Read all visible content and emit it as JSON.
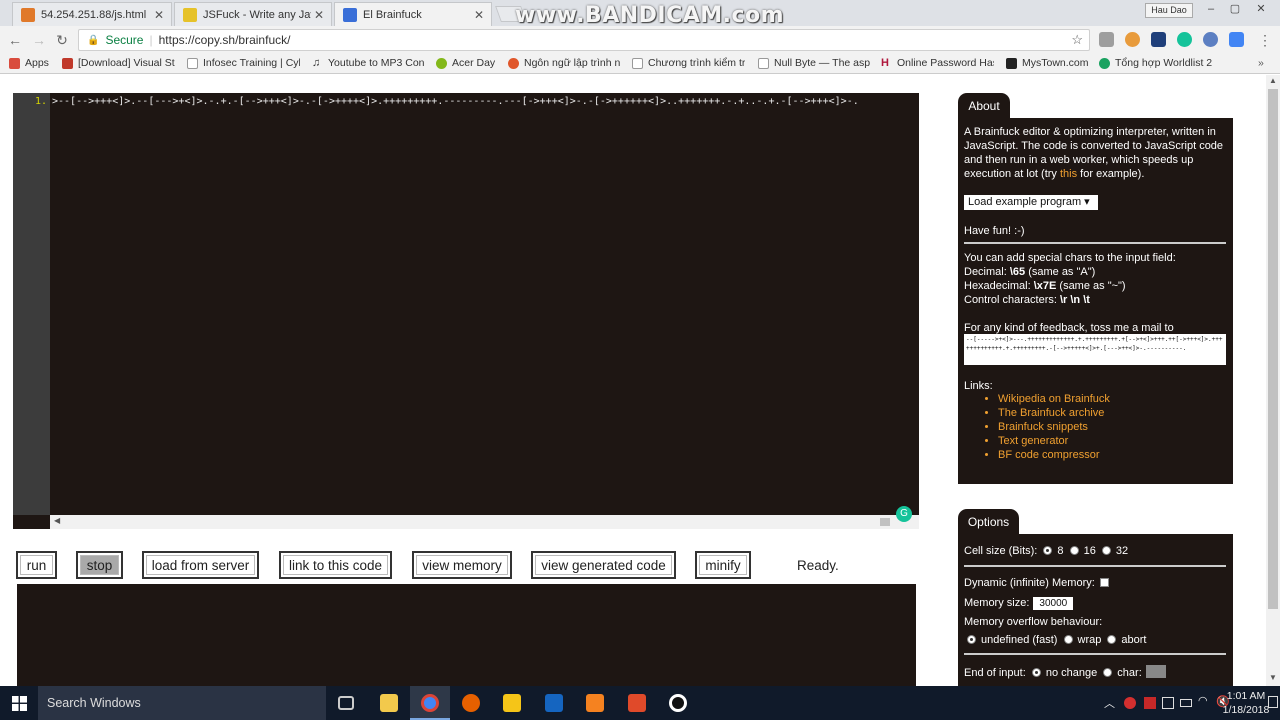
{
  "browser": {
    "tabs": [
      {
        "title": "54.254.251.88/js.html",
        "favicon_color": "#e0792a"
      },
      {
        "title": "JSFuck - Write any JavaSc",
        "favicon_color": "#e6c229"
      },
      {
        "title": "El Brainfuck",
        "favicon_color": "#3a6fd8"
      }
    ],
    "overlay_watermark": "www.BANDICAM.com",
    "profile_name": "Hau Dao",
    "window_controls": [
      "–",
      "▢",
      "✕"
    ],
    "address": {
      "secure_label": "Secure",
      "url": "https://copy.sh/brainfuck/"
    },
    "bookmarks": [
      {
        "label": "Apps",
        "icon_color": "#d94c3d"
      },
      {
        "label": "[Download] Visual St",
        "icon_color": "#c0392b"
      },
      {
        "label": "Infosec Training | Cyb",
        "icon_color": "#999999"
      },
      {
        "label": "Youtube to MP3 Con",
        "icon_color": "#333333"
      },
      {
        "label": "Acer Day",
        "icon_color": "#83b81a"
      },
      {
        "label": "Ngôn ngữ lập trình n",
        "icon_color": "#e0562a"
      },
      {
        "label": "Chương trình kiểm tr",
        "icon_color": "#999999"
      },
      {
        "label": "Null Byte — The aspi",
        "icon_color": "#999999"
      },
      {
        "label": "Online Password Has",
        "icon_color": "#b0173c"
      },
      {
        "label": "MysTown.com",
        "icon_color": "#222222"
      },
      {
        "label": "Tổng hợp Worldlist 2",
        "icon_color": "#1aa260"
      }
    ]
  },
  "editor": {
    "line_number": "1.",
    "code": ">--[-->+++<]>.--[--->+<]>.-.+.-[-->+++<]>-.-[->++++<]>.+++++++++.---------.---[->+++<]>-.-[->++++++<]>..+++++++.-.+..-.+.-[-->+++<]>-."
  },
  "controls": {
    "buttons": [
      "run",
      "stop",
      "load from server",
      "link to this code",
      "view memory",
      "view generated code",
      "minify"
    ],
    "status": "Ready."
  },
  "about": {
    "tab_label": "About",
    "intro_1": "A Brainfuck editor & optimizing interpreter, written in JavaScript. The code is converted to JavaScript code and then run in a web worker, which speeds up execution at lot (try ",
    "intro_link": "this",
    "intro_2": " for example).",
    "load_example": "Load example program ▾",
    "have_fun": "Have fun! :-)",
    "special_chars_title": "You can add special chars to the input field:",
    "decimal_label": "Decimal: ",
    "decimal_code": "\\65",
    "decimal_note": " (same as \"A\")",
    "hex_label": "Hexadecimal: ",
    "hex_code": "\\x7E",
    "hex_note": " (same as \"~\")",
    "control_label": "Control characters: ",
    "control_code": "\\r \\n \\t",
    "feedback": "For any kind of feedback, toss me a mail to",
    "mail_code": "--[----->+<]>---.+++++++++++++.+.+++++++++.+[-->+<]>+++.++[->+++<]>.+++++++++++++.+.+++++++++.-[-->+++++<]>+.[--->++<]>-.----------.",
    "links_label": "Links:",
    "links": [
      "Wikipedia on Brainfuck",
      "The Brainfuck archive",
      "Brainfuck snippets",
      "Text generator",
      "BF code compressor"
    ]
  },
  "options": {
    "tab_label": "Options",
    "cell_size_label": "Cell size (Bits):",
    "cell_sizes": [
      "8",
      "16",
      "32"
    ],
    "cell_size_selected": "8",
    "dynamic_memory_label": "Dynamic (infinite) Memory:",
    "memory_size_label": "Memory size:",
    "memory_size_value": "30000",
    "overflow_label": "Memory overflow behaviour:",
    "overflow_options": [
      "undefined (fast)",
      "wrap",
      "abort"
    ],
    "overflow_selected": "undefined (fast)",
    "end_input_label": "End of input:",
    "end_input_options": [
      "no change",
      "char:"
    ],
    "end_input_selected": "no change"
  },
  "taskbar": {
    "search_placeholder": "Search Windows",
    "time": "1:01 AM",
    "date": "1/18/2018",
    "app_icon_colors": [
      "#cccccc",
      "#f2c94c",
      "#4285f4",
      "#e66000",
      "#f5c518",
      "#1565c0",
      "#f58220",
      "#e04a2a",
      "#d32f2f"
    ]
  }
}
